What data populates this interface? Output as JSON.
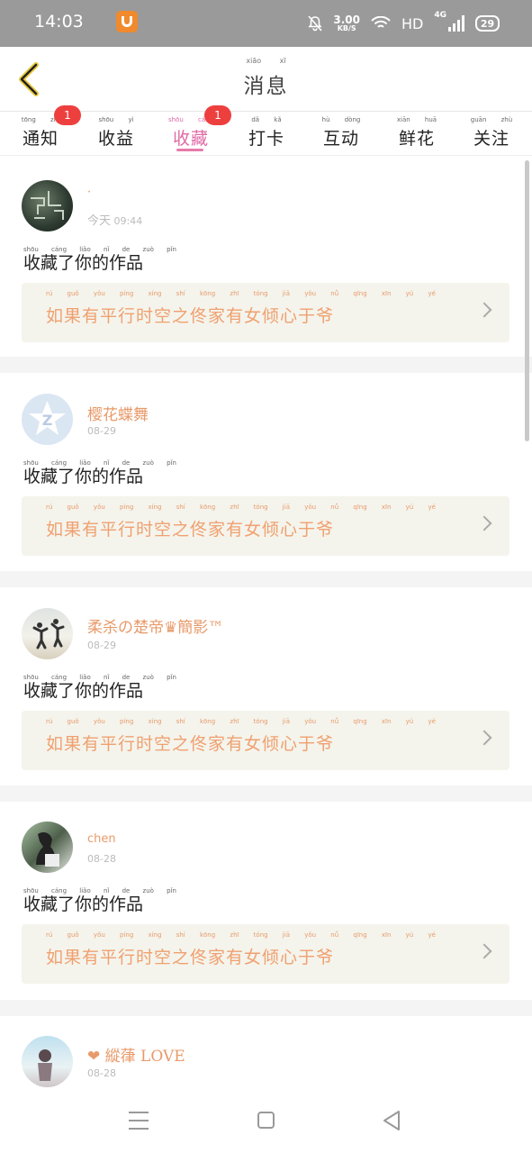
{
  "status_bar": {
    "time": "14:03",
    "speed_value": "3.00",
    "speed_unit": "KB/S",
    "network": "HD",
    "signal": "4G",
    "battery": "29",
    "icons": [
      "uc-browser-icon",
      "mute-bell-icon",
      "wifi-icon",
      "signal-icon",
      "battery-icon"
    ]
  },
  "header": {
    "title_pinyin": "xiāo xī",
    "title": "消息",
    "back_icon": "chevron-left-icon"
  },
  "tabs": [
    {
      "label": "通知",
      "pinyin": "tōng zhī",
      "badge": "1"
    },
    {
      "label": "收益",
      "pinyin": "shōu yì",
      "badge": ""
    },
    {
      "label": "收藏",
      "pinyin": "shōu cáng",
      "badge": "1",
      "active": true
    },
    {
      "label": "打卡",
      "pinyin": "dǎ kǎ",
      "badge": ""
    },
    {
      "label": "互动",
      "pinyin": "hù dòng",
      "badge": ""
    },
    {
      "label": "鲜花",
      "pinyin": "xiān huā",
      "badge": ""
    },
    {
      "label": "关注",
      "pinyin": "guān zhù",
      "badge": ""
    }
  ],
  "colors": {
    "accent_pink": "#e06aa5",
    "name_orange": "#e89a6a",
    "badge_red": "#ee3f3f",
    "card_bg": "#f4f4ec"
  },
  "feed": [
    {
      "name": "·",
      "sub_name": "今天",
      "time": "09:44",
      "action_pinyin": "shōu cáng liǎo nǐ de zuò pǐn",
      "action": "收藏了你的作品",
      "work_pinyin": "rú guǒ yǒu píng xíng shí kōng zhī tóng jiā yǒu nǚ qīng xīn yú yé",
      "work_title": "如果有平行时空之佟家有女倾心于爷"
    },
    {
      "name": "樱花蝶舞",
      "sub_name": "",
      "time": "08-29",
      "action_pinyin": "shōu cáng liǎo nǐ de zuò pǐn",
      "action": "收藏了你的作品",
      "work_pinyin": "rú guǒ yǒu píng xíng shí kōng zhī tóng jiā yǒu nǚ qīng xīn yú yé",
      "work_title": "如果有平行时空之佟家有女倾心于爷"
    },
    {
      "name": "柔杀の楚帝♛簡影™",
      "sub_name": "",
      "time": "08-29",
      "action_pinyin": "shōu cáng liǎo nǐ de zuò pǐn",
      "action": "收藏了你的作品",
      "work_pinyin": "rú guǒ yǒu píng xíng shí kōng zhī tóng jiā yǒu nǚ qīng xīn yú yé",
      "work_title": "如果有平行时空之佟家有女倾心于爷"
    },
    {
      "name": "chen",
      "sub_name": "",
      "time": "08-28",
      "action_pinyin": "shōu cáng liǎo nǐ de zuò pǐn",
      "action": "收藏了你的作品",
      "work_pinyin": "rú guǒ yǒu píng xíng shí kōng zhī tóng jiā yǒu nǚ qīng xīn yú yé",
      "work_title": "如果有平行时空之佟家有女倾心于爷"
    },
    {
      "name": "❤ 縱葎 LOVE",
      "sub_name": "",
      "time": "08-28"
    }
  ],
  "nav_bar": {
    "icons": [
      "menu-icon",
      "home-square-icon",
      "back-triangle-icon"
    ]
  }
}
